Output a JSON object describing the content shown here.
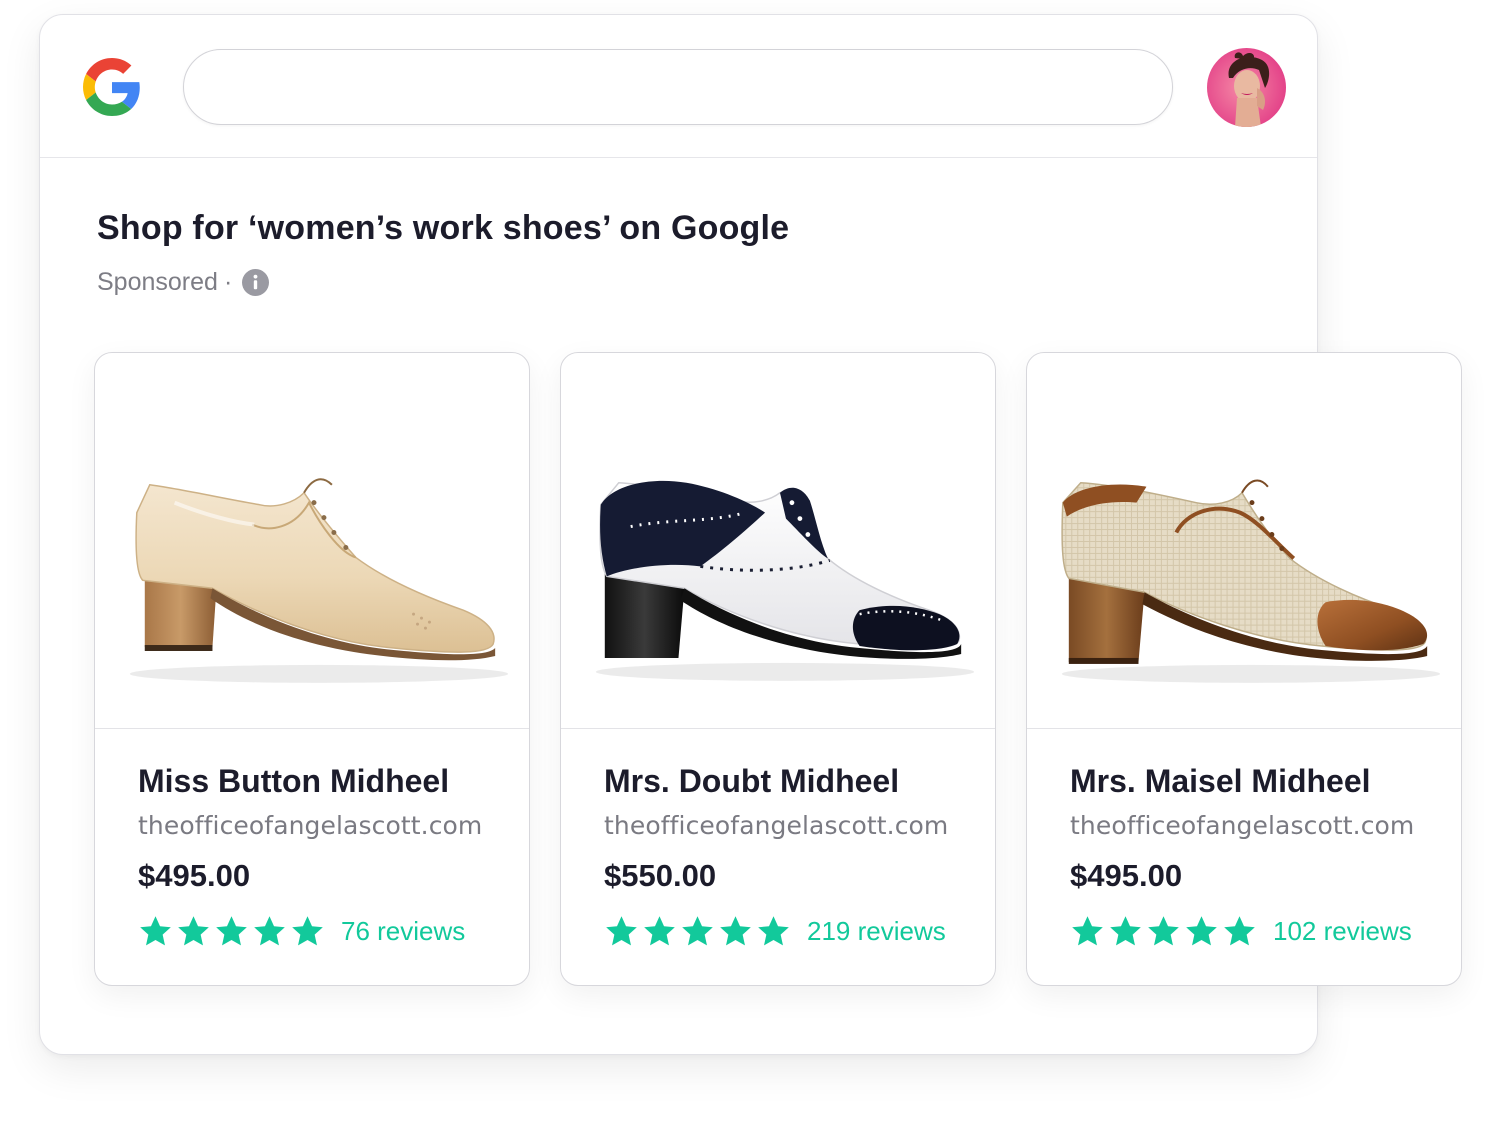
{
  "header": {
    "logo_icon": "google-logo-icon",
    "search": {
      "value": "",
      "placeholder": ""
    },
    "avatar_icon": "user-avatar"
  },
  "results": {
    "title": "Shop for ‘women’s work shoes’ on Google",
    "sponsored_label": "Sponsored",
    "separator": "·",
    "info_icon": "info-icon"
  },
  "products": [
    {
      "name": "Miss Button Midheel",
      "domain": "theofficeofangelascott.com",
      "price": "$495.00",
      "rating": 5,
      "reviews": "76 reviews",
      "image_icon": "cream-patent-oxford-shoe"
    },
    {
      "name": "Mrs. Doubt Midheel",
      "domain": "theofficeofangelascott.com",
      "price": "$550.00",
      "rating": 5,
      "reviews": "219 reviews",
      "image_icon": "black-white-brogue-shoe"
    },
    {
      "name": "Mrs. Maisel Midheel",
      "domain": "theofficeofangelascott.com",
      "price": "$495.00",
      "rating": 5,
      "reviews": "102 reviews",
      "image_icon": "linen-brown-toecap-shoe"
    }
  ],
  "colors": {
    "star": "#12c99b",
    "reviews_text": "#12c99b",
    "heading": "#1c1c2b",
    "muted": "#7a7a82"
  }
}
